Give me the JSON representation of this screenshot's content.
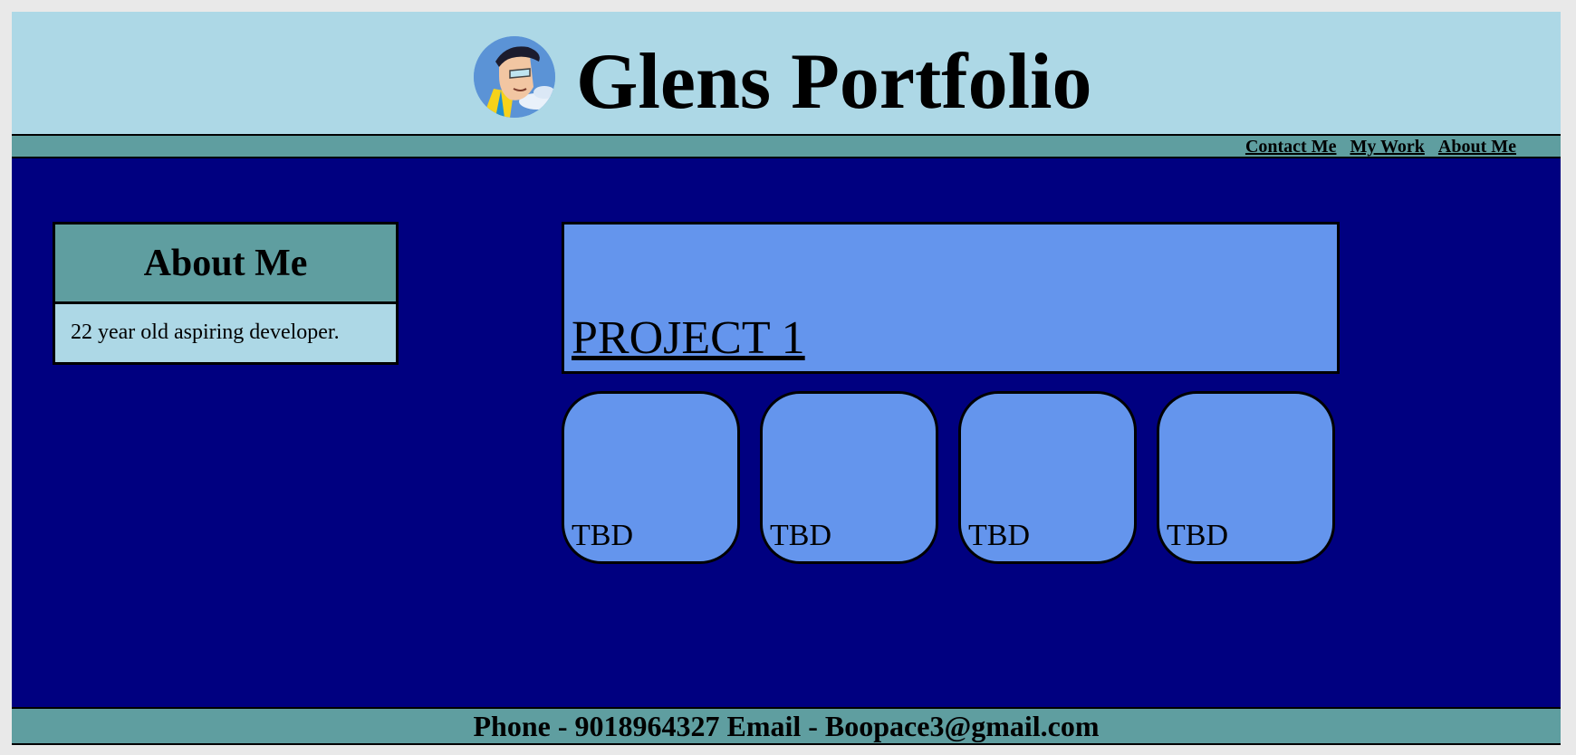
{
  "header": {
    "title": "Glens Portfolio",
    "avatar_icon": "avatar-icon"
  },
  "nav": {
    "links": [
      {
        "label": "Contact Me"
      },
      {
        "label": "My Work"
      },
      {
        "label": "About Me"
      }
    ]
  },
  "about": {
    "heading": "About Me",
    "text": "22 year old aspiring developer."
  },
  "projects": {
    "featured": "PROJECT 1",
    "tiles": [
      {
        "label": "TBD"
      },
      {
        "label": "TBD"
      },
      {
        "label": "TBD"
      },
      {
        "label": "TBD"
      }
    ]
  },
  "footer": {
    "contact": "Phone - 9018964327 Email - Boopace3@gmail.com"
  },
  "colors": {
    "header_bg": "#add8e6",
    "nav_bg": "#5f9ea0",
    "page_bg": "#000080",
    "card_bg": "#6495ed",
    "text": "#000000"
  }
}
